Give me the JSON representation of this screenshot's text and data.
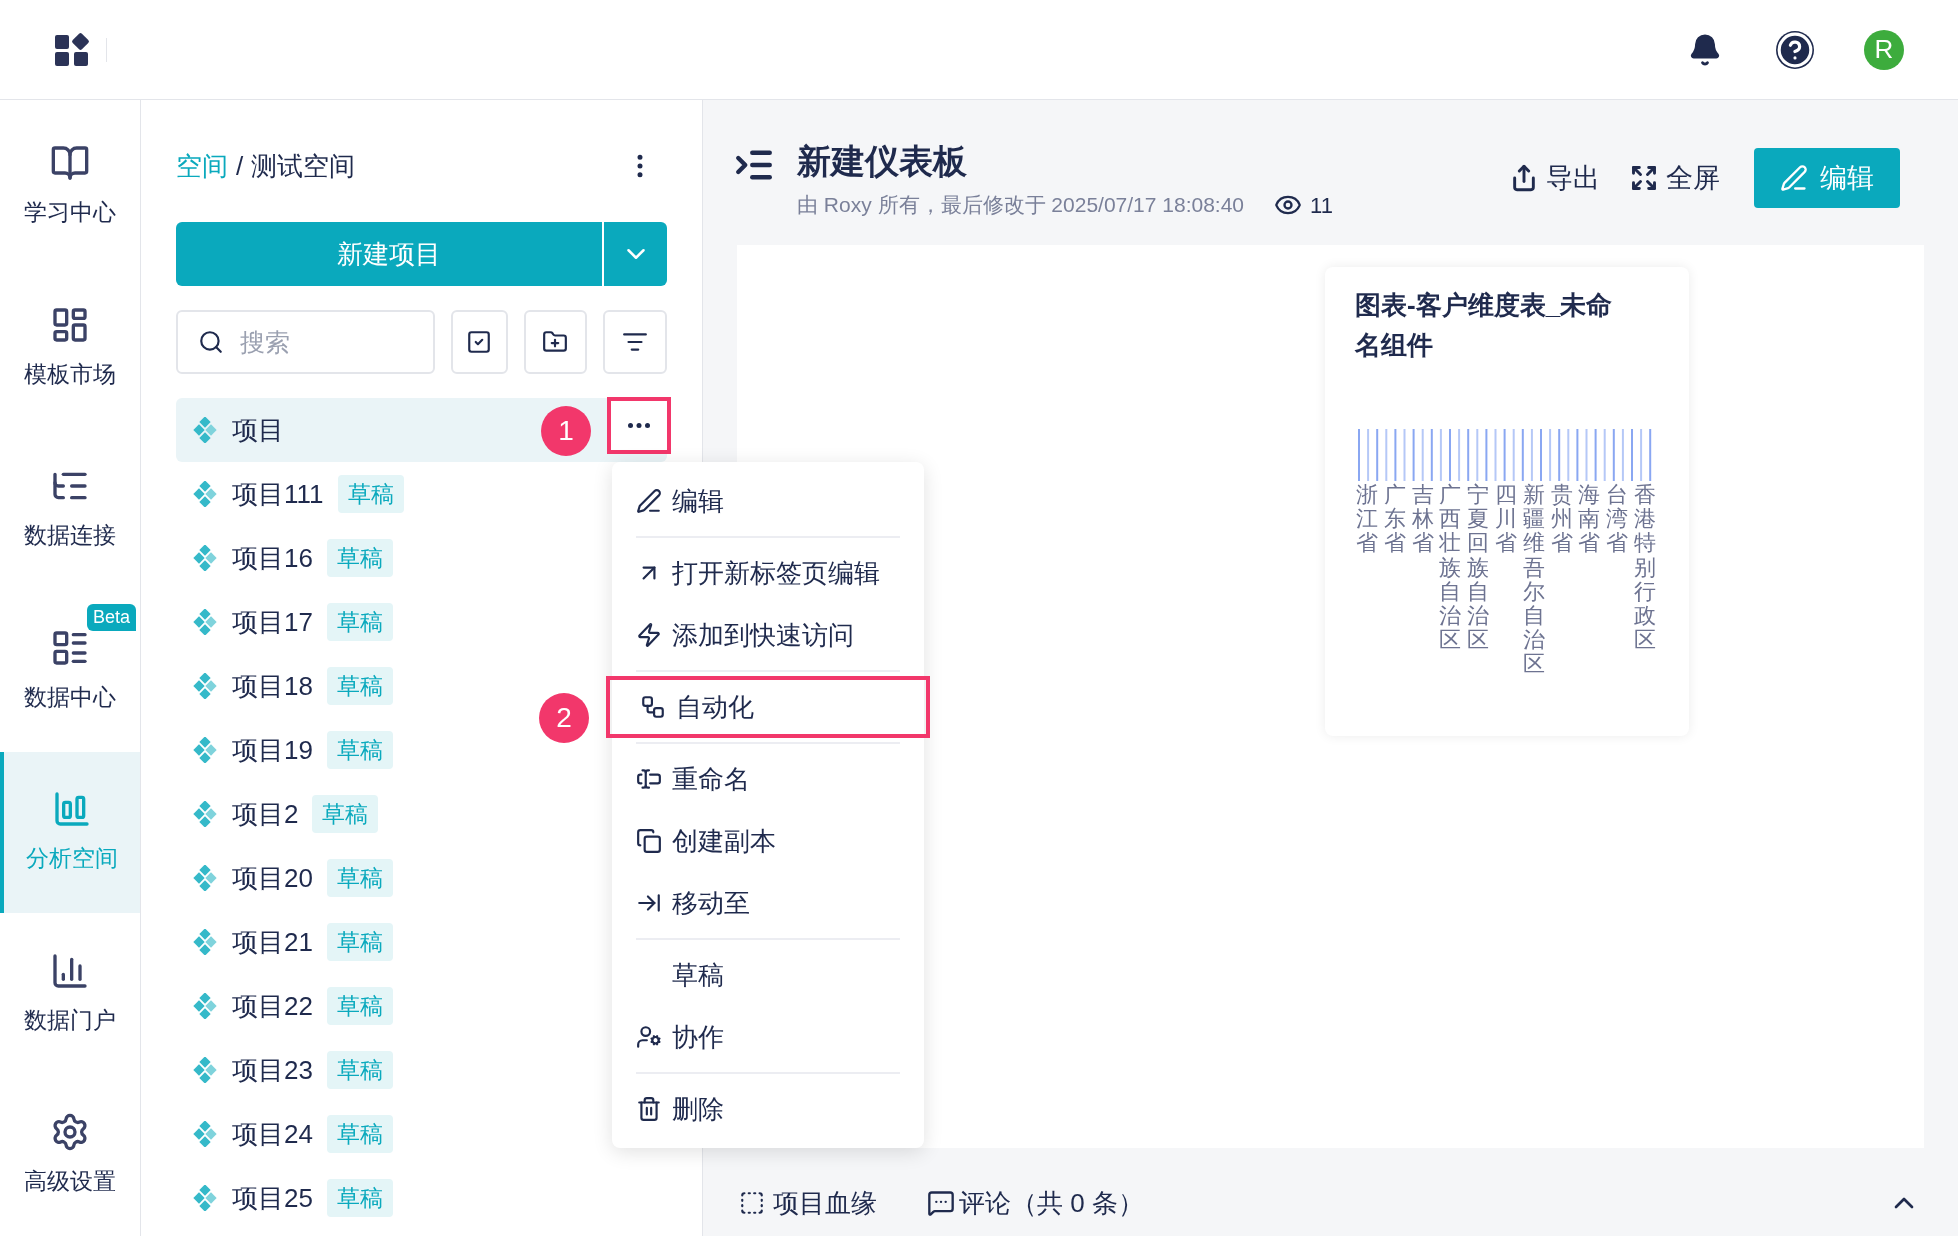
{
  "header": {
    "avatar": "R"
  },
  "nav": [
    {
      "label": "学习中心",
      "selected": false
    },
    {
      "label": "模板市场",
      "selected": false
    },
    {
      "label": "数据连接",
      "selected": false
    },
    {
      "label": "数据中心",
      "selected": false,
      "badge": "Beta"
    },
    {
      "label": "分析空间",
      "selected": true
    },
    {
      "label": "数据门户",
      "selected": false
    },
    {
      "label": "高级设置",
      "selected": false
    }
  ],
  "breadcrumb": {
    "root": "空间",
    "separator": "/",
    "current": "测试空间"
  },
  "new_button": "新建项目",
  "search": {
    "placeholder": "搜索"
  },
  "projects": [
    {
      "name": "项目",
      "selected": true
    },
    {
      "name": "项目111",
      "tag": "草稿",
      "selected": false
    },
    {
      "name": "项目16",
      "tag": "草稿",
      "selected": false
    },
    {
      "name": "项目17",
      "tag": "草稿",
      "selected": false
    },
    {
      "name": "项目18",
      "tag": "草稿",
      "selected": false
    },
    {
      "name": "项目19",
      "tag": "草稿",
      "selected": false
    },
    {
      "name": "项目2",
      "tag": "草稿",
      "selected": false
    },
    {
      "name": "项目20",
      "tag": "草稿",
      "selected": false
    },
    {
      "name": "项目21",
      "tag": "草稿",
      "selected": false
    },
    {
      "name": "项目22",
      "tag": "草稿",
      "selected": false
    },
    {
      "name": "项目23",
      "tag": "草稿",
      "selected": false
    },
    {
      "name": "项目24",
      "tag": "草稿",
      "selected": false
    },
    {
      "name": "项目25",
      "tag": "草稿",
      "selected": false
    }
  ],
  "step_badges": [
    "1",
    "2"
  ],
  "context_menu": [
    [
      {
        "label": "编辑",
        "highlighted": false
      }
    ],
    [
      {
        "label": "打开新标签页编辑",
        "highlighted": false
      },
      {
        "label": "添加到快速访问",
        "highlighted": false
      }
    ],
    [
      {
        "label": "自动化",
        "highlighted": true
      }
    ],
    [
      {
        "label": "重命名",
        "highlighted": false
      },
      {
        "label": "创建副本",
        "highlighted": false
      },
      {
        "label": "移动至",
        "highlighted": false
      }
    ],
    [
      {
        "label": "草稿",
        "highlighted": false
      },
      {
        "label": "协作",
        "highlighted": false
      }
    ],
    [
      {
        "label": "删除",
        "highlighted": false
      }
    ]
  ],
  "dashboard": {
    "title": "新建仪表板",
    "meta": "由 Roxy 所有，最后修改于 2025/07/17 18:08:40",
    "views": "11",
    "actions": [
      "导出",
      "全屏"
    ],
    "edit": "编辑"
  },
  "chart_card": {
    "title": "图表-客户维度表_未命名组件",
    "categories": [
      "浙江省",
      "广东省",
      "吉林省",
      "广西壮族自治区",
      "宁夏回族自治区",
      "四川省",
      "新疆维吾尔自治区",
      "贵州省",
      "海南省",
      "台湾省",
      "香港特别行政区"
    ]
  },
  "footer": {
    "lineage": "项目血缘",
    "comments": "评论（共 0 条）"
  }
}
